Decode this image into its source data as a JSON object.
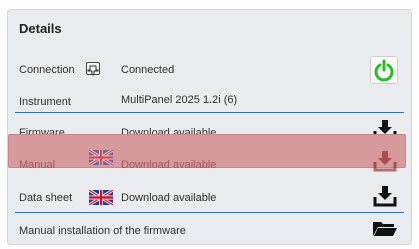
{
  "panel": {
    "title": "Details"
  },
  "rows": {
    "connection": {
      "label": "Connection",
      "value": "Connected"
    },
    "instrument": {
      "label": "Instrument",
      "value": "MultiPanel 2025   1.2i  (6)"
    },
    "firmware": {
      "label": "Firmware",
      "value": "Download available"
    },
    "manual": {
      "label": "Manual",
      "value": "Download available"
    },
    "datasheet": {
      "label": "Data sheet",
      "value": "Download available"
    },
    "manual_install": {
      "label": "Manual installation of the firmware"
    }
  },
  "colors": {
    "accent_blue": "#2f6fb5",
    "power_green": "#2dbb2d",
    "highlight_red": "#d79a9c"
  },
  "icons": {
    "connection": "pin-icon",
    "power": "power-icon",
    "download": "download-icon",
    "flag": "uk-flag-icon",
    "folder": "folder-icon"
  }
}
